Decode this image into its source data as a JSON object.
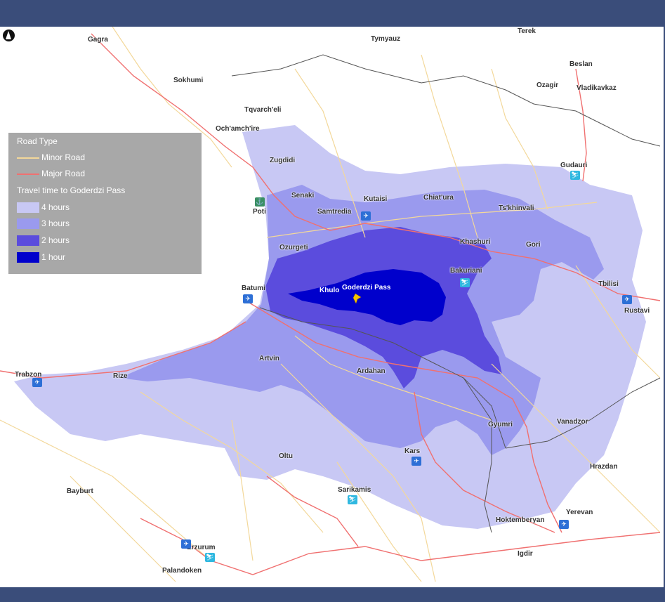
{
  "legend": {
    "road_type_title": "Road Type",
    "minor_road": "Minor Road",
    "major_road": "Major Road",
    "travel_title": "Travel time to Goderdzi Pass",
    "zones": [
      "4 hours",
      "3 hours",
      "2 hours",
      "1 hour"
    ]
  },
  "colors": {
    "zone_4h": "#c8c8f4",
    "zone_3h": "#9a9aee",
    "zone_2h": "#5b4cdd",
    "zone_1h": "#0000cc",
    "minor_road": "#f3d89a",
    "major_road": "#f07070",
    "border": "#555555",
    "frame": "#3a4d7a"
  },
  "places": {
    "gagra": "Gagra",
    "tymyauz": "Tymyauz",
    "terek": "Terek",
    "beslan": "Beslan",
    "ozagir": "Ozagir",
    "vladikavkaz": "Vladikavkaz",
    "sokhumi": "Sokhumi",
    "tqvarcheli": "Tqvarch'eli",
    "ochamchire": "Och'amch'ire",
    "zugdidi": "Zugdidi",
    "gudauri": "Gudauri",
    "senaki": "Senaki",
    "poti": "Poti",
    "kutaisi": "Kutaisi",
    "samtredia": "Samtredia",
    "chiatura": "Chiat'ura",
    "tskhinvali": "Ts'khinvali",
    "ozurgeti": "Ozurgeti",
    "khashuri": "Khashuri",
    "gori": "Gori",
    "bakuriani": "Bakuriani",
    "tbilisi": "Tbilisi",
    "batumi": "Batumi",
    "khulo": "Khulo",
    "goderdzi": "Goderdzi Pass",
    "rustavi": "Rustavi",
    "trabzon": "Trabzon",
    "rize": "Rize",
    "artvin": "Artvin",
    "ardahan": "Ardahan",
    "gyumri": "Gyumri",
    "vanadzor": "Vanadzor",
    "oltu": "Oltu",
    "kars": "Kars",
    "hrazdan": "Hrazdan",
    "bayburt": "Bayburt",
    "sarikamis": "Sarikamis",
    "yerevan": "Yerevan",
    "hoktemberyan": "Hoktemberyan",
    "erzurum": "Erzurum",
    "igdir": "Igdir",
    "palandoken": "Palandoken"
  },
  "icons": [
    "north-arrow",
    "airport",
    "ski-resort",
    "port",
    "destination-marker"
  ]
}
